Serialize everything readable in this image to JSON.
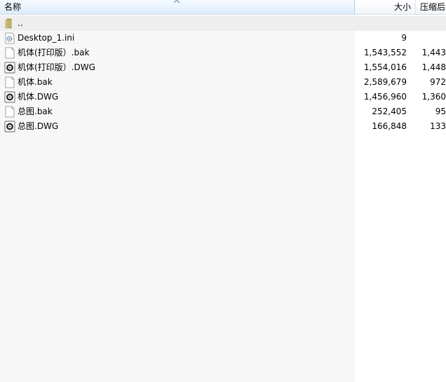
{
  "columns": {
    "name": "名称",
    "size": "大小",
    "packed": "压缩后"
  },
  "rows": [
    {
      "name": "..",
      "size": "",
      "packed": "",
      "icon": "folder-icon"
    },
    {
      "name": "Desktop_1.ini",
      "size": "9",
      "packed": "",
      "icon": "ini-settings-icon"
    },
    {
      "name": "机体(打印版）.bak",
      "size": "1,543,552",
      "packed": "1,443",
      "icon": "file-icon"
    },
    {
      "name": "机体(打印版）.DWG",
      "size": "1,554,016",
      "packed": "1,448",
      "icon": "dwg-file-icon"
    },
    {
      "name": "机体.bak",
      "size": "2,589,679",
      "packed": "972",
      "icon": "file-icon"
    },
    {
      "name": "机体.DWG",
      "size": "1,456,960",
      "packed": "1,360",
      "icon": "dwg-file-icon"
    },
    {
      "name": "总图.bak",
      "size": "252,405",
      "packed": "95",
      "icon": "file-icon"
    },
    {
      "name": "总图.DWG",
      "size": "166,848",
      "packed": "133",
      "icon": "dwg-file-icon"
    }
  ]
}
